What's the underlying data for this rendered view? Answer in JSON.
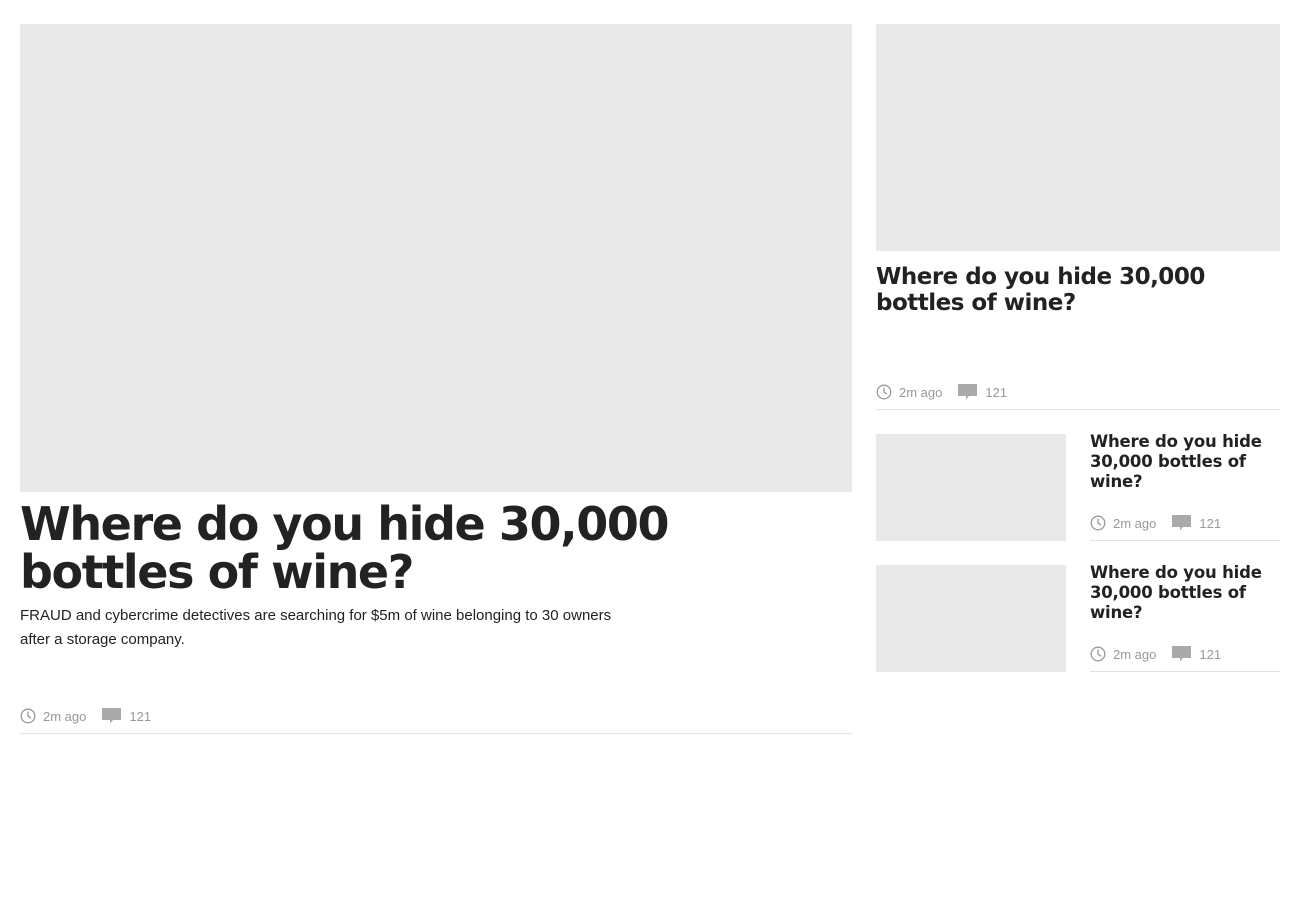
{
  "colors": {
    "placeholder": "#e9e9e9",
    "headline": "#222222",
    "meta": "#999999",
    "divider": "#e2e2e2"
  },
  "hero": {
    "title": "Where do you hide 30,000 bottles of wine?",
    "standfirst": "FRAUD and cybercrime detectives are searching for $5m of wine belonging to 30 owners after a storage company.",
    "time": "2m ago",
    "comments": "121"
  },
  "side_feature": {
    "title": "Where do you hide 30,000 bottles of wine?",
    "time": "2m ago",
    "comments": "121"
  },
  "small_stories": [
    {
      "title": "Where do you hide 30,000 bottles of wine?",
      "time": "2m ago",
      "comments": "121"
    },
    {
      "title": "Where do you hide 30,000 bottles of wine?",
      "time": "2m ago",
      "comments": "121"
    }
  ],
  "icons": {
    "time": "clock-icon",
    "comments": "comment-bubble-icon"
  }
}
